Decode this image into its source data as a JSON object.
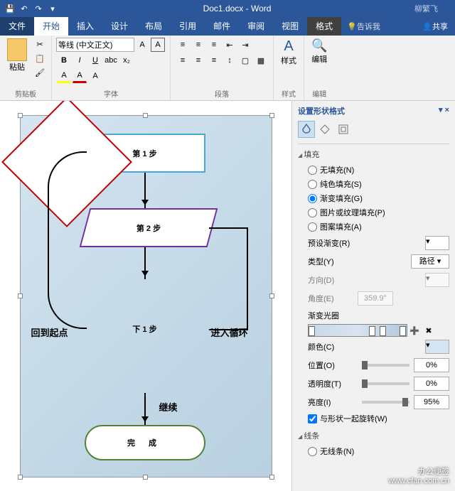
{
  "titlebar": {
    "doc": "Doc1.docx - Word",
    "user": "柳繁飞"
  },
  "tabs": {
    "file": "文件",
    "home": "开始",
    "insert": "插入",
    "design": "设计",
    "layout": "布局",
    "ref": "引用",
    "mail": "邮件",
    "review": "审阅",
    "view": "视图",
    "format": "格式",
    "tellme": "告诉我",
    "share": "共享"
  },
  "ribbon": {
    "clipboard": "剪贴板",
    "paste": "粘贴",
    "font": "字体",
    "font_name": "等线 (中文正文)",
    "para": "段落",
    "styles": "样式",
    "styles_btn": "样式",
    "edit": "编辑",
    "edit_btn": "编辑"
  },
  "flow": {
    "s1": "第 1 步",
    "s2": "第 2 步",
    "s3": "下 1 步",
    "done": "完 成",
    "back": "回到起点",
    "loop": "进入循环",
    "cont": "继续"
  },
  "pane": {
    "title": "设置形状格式",
    "fill": "填充",
    "nofill": "无填充(N)",
    "solid": "纯色填充(S)",
    "grad": "渐变填充(G)",
    "pic": "图片或纹理填充(P)",
    "patt": "图案填充(A)",
    "preset": "预设渐变(R)",
    "type": "类型(Y)",
    "type_val": "路径",
    "dir": "方向(D)",
    "angle": "角度(E)",
    "angle_val": "359.9°",
    "stops": "渐变光圈",
    "color": "颜色(C)",
    "pos": "位置(O)",
    "pos_val": "0%",
    "trans": "透明度(T)",
    "trans_val": "0%",
    "bright": "亮度(I)",
    "bright_val": "95%",
    "rotate": "与形状一起旋转(W)",
    "line": "线条",
    "noline": "无线条(N)"
  },
  "watermark": {
    "l1": "办公便签",
    "l2": "www.cfan.com.cn"
  }
}
